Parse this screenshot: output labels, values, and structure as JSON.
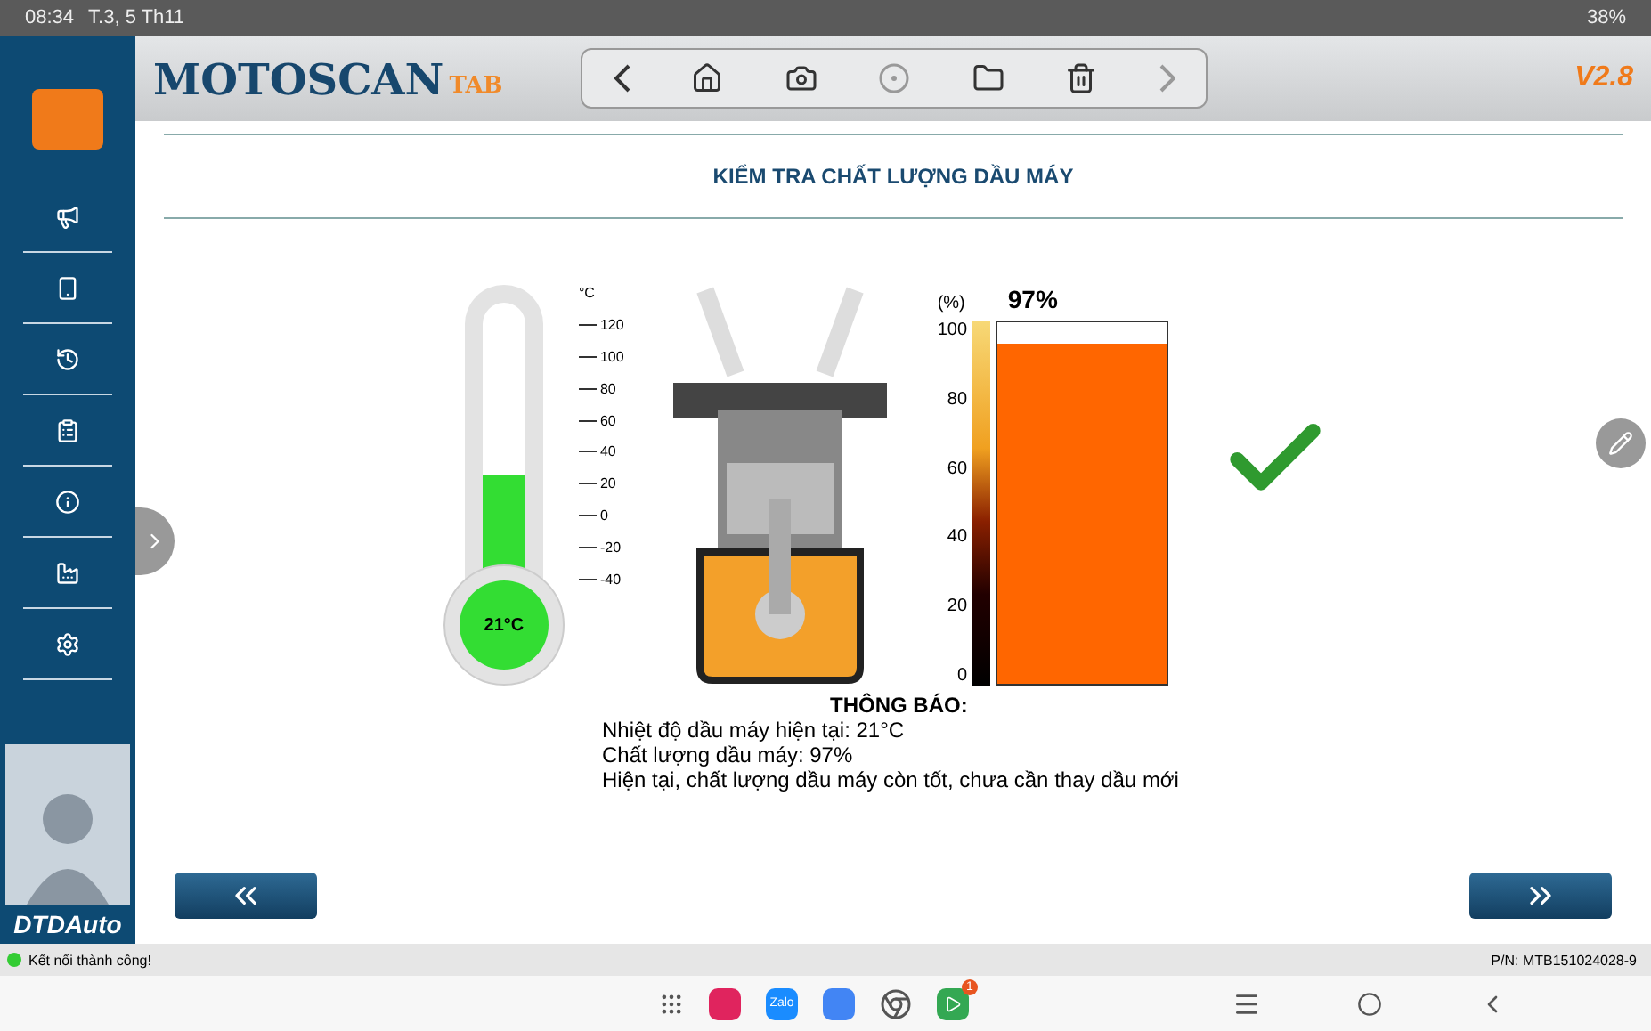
{
  "status_bar": {
    "time": "08:34",
    "date": "T.3, 5 Th11",
    "battery": "38%"
  },
  "header": {
    "logo": "MOTOSCAN",
    "logo_suffix": "TAB",
    "version": "V2.8"
  },
  "toolbar": [
    {
      "kind": "back",
      "disabled": false
    },
    {
      "kind": "home",
      "disabled": false
    },
    {
      "kind": "camera",
      "disabled": false
    },
    {
      "kind": "record",
      "disabled": true
    },
    {
      "kind": "folder",
      "disabled": false
    },
    {
      "kind": "delete",
      "disabled": false
    },
    {
      "kind": "forward",
      "disabled": true
    }
  ],
  "sidebar": {
    "items": [
      {
        "kind": "announce"
      },
      {
        "kind": "device"
      },
      {
        "kind": "history"
      },
      {
        "kind": "report"
      },
      {
        "kind": "info"
      },
      {
        "kind": "factory"
      },
      {
        "kind": "settings"
      }
    ],
    "brand": "DTDAuto"
  },
  "page": {
    "title": "KIỂM TRA CHẤT LƯỢNG DẦU MÁY",
    "thermometer": {
      "unit": "°C",
      "ticks": [
        "120",
        "100",
        "80",
        "60",
        "40",
        "20",
        "0",
        "-20",
        "-40"
      ],
      "level": 0.46,
      "reading": "21°C"
    },
    "oil_meter": {
      "unit": "(%)",
      "reading": "97%",
      "ticks": [
        "100",
        "80",
        "60",
        "40",
        "20",
        "0"
      ],
      "level": 0.94
    },
    "result": {
      "ok": true
    },
    "message": {
      "heading": "THÔNG BÁO:",
      "lines": [
        "Nhiệt độ dầu máy hiện tại: 21°C",
        "Chất lượng dầu máy: 97%",
        "Hiện tại, chất lượng dầu máy còn tốt, chưa cần thay dầu mới"
      ]
    }
  },
  "footer": {
    "connection": "Kết nối thành công!",
    "connected": true,
    "serial": "P/N: MTB151024028-9"
  },
  "nav_bar": {
    "zalo": "Zalo",
    "badge": "1"
  }
}
